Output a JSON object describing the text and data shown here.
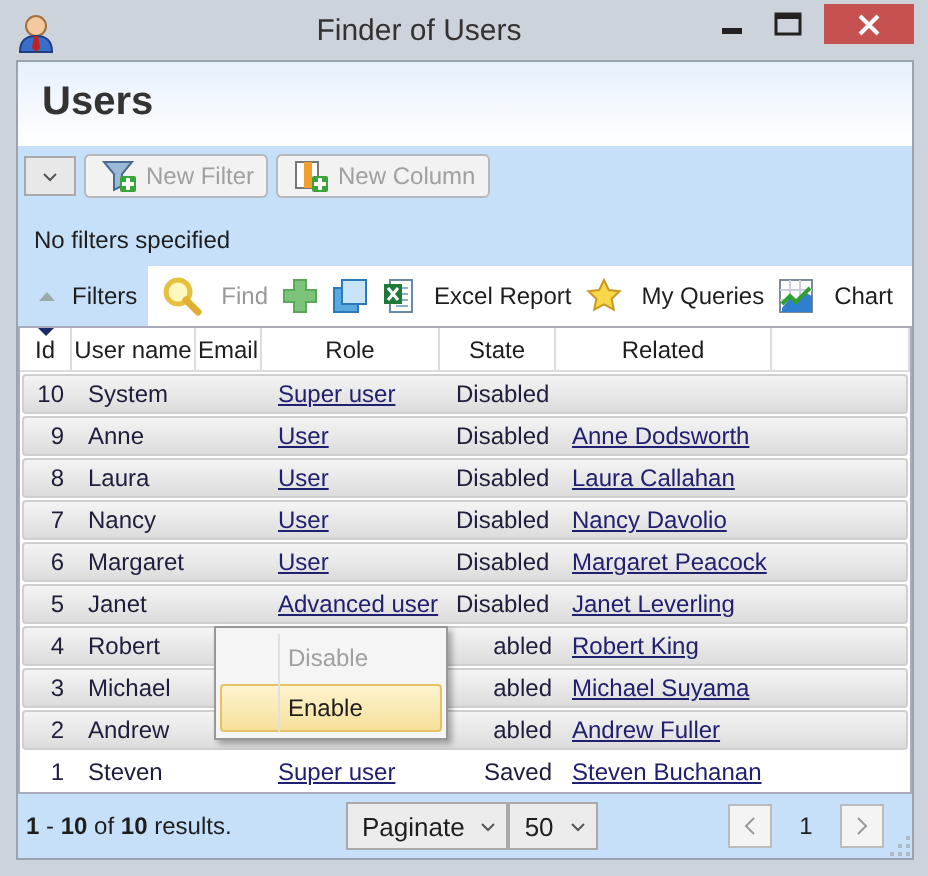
{
  "window": {
    "title": "Finder of Users"
  },
  "header": {
    "title": "Users"
  },
  "filter_bar": {
    "buttons": [
      {
        "kind": "filter",
        "label": "New Filter",
        "disabled": true
      },
      {
        "kind": "column",
        "label": "New Column",
        "disabled": true
      }
    ],
    "status": "No filters specified"
  },
  "toolbar": {
    "filters_tab": {
      "label": "Filters",
      "expanded": true,
      "selected": true
    },
    "items": [
      {
        "kind": "find",
        "label": "Find",
        "disabled": true
      },
      {
        "kind": "add"
      },
      {
        "kind": "copy"
      },
      {
        "kind": "excel",
        "label": "Excel Report"
      },
      {
        "kind": "favorites",
        "label": "My Queries"
      },
      {
        "kind": "chart",
        "label": "Chart"
      }
    ]
  },
  "table": {
    "columns": [
      {
        "label": "Id",
        "sorted": true
      },
      {
        "label": "User name"
      },
      {
        "label": "Email"
      },
      {
        "label": "Role"
      },
      {
        "label": "State"
      },
      {
        "label": "Related"
      }
    ],
    "rows": [
      {
        "id": "10",
        "user_name": "System",
        "role": "Super user",
        "state": "Disabled",
        "selected": true
      },
      {
        "id": "9",
        "user_name": "Anne",
        "role": "User",
        "state": "Disabled",
        "related": "Anne Dodsworth",
        "selected": true
      },
      {
        "id": "8",
        "user_name": "Laura",
        "role": "User",
        "state": "Disabled",
        "related": "Laura Callahan",
        "selected": true
      },
      {
        "id": "7",
        "user_name": "Nancy",
        "role": "User",
        "state": "Disabled",
        "related": "Nancy Davolio",
        "selected": true
      },
      {
        "id": "6",
        "user_name": "Margaret",
        "role": "User",
        "state": "Disabled",
        "related": "Margaret Peacock",
        "selected": true
      },
      {
        "id": "5",
        "user_name": "Janet",
        "role": "Advanced user",
        "state": "Disabled",
        "related": "Janet Leverling",
        "selected": true
      },
      {
        "id": "4",
        "user_name": "Robert",
        "state": "abled",
        "related": "Robert King",
        "selected": true
      },
      {
        "id": "3",
        "user_name": "Michael",
        "state": "abled",
        "related": "Michael Suyama",
        "selected": true
      },
      {
        "id": "2",
        "user_name": "Andrew",
        "state": "abled",
        "related": "Andrew Fuller",
        "selected": true
      },
      {
        "id": "1",
        "user_name": "Steven",
        "role": "Super user",
        "state": "Saved",
        "related": "Steven Buchanan",
        "selected": false
      }
    ]
  },
  "context_menu": {
    "items": [
      {
        "label": "Disable",
        "disabled": true,
        "highlighted": false
      },
      {
        "label": "Enable",
        "disabled": false,
        "highlighted": true
      }
    ]
  },
  "footer": {
    "summary": "**1** - **10** of **10** results.",
    "paginate": "Paginate",
    "page_size": "50",
    "page": "1"
  }
}
